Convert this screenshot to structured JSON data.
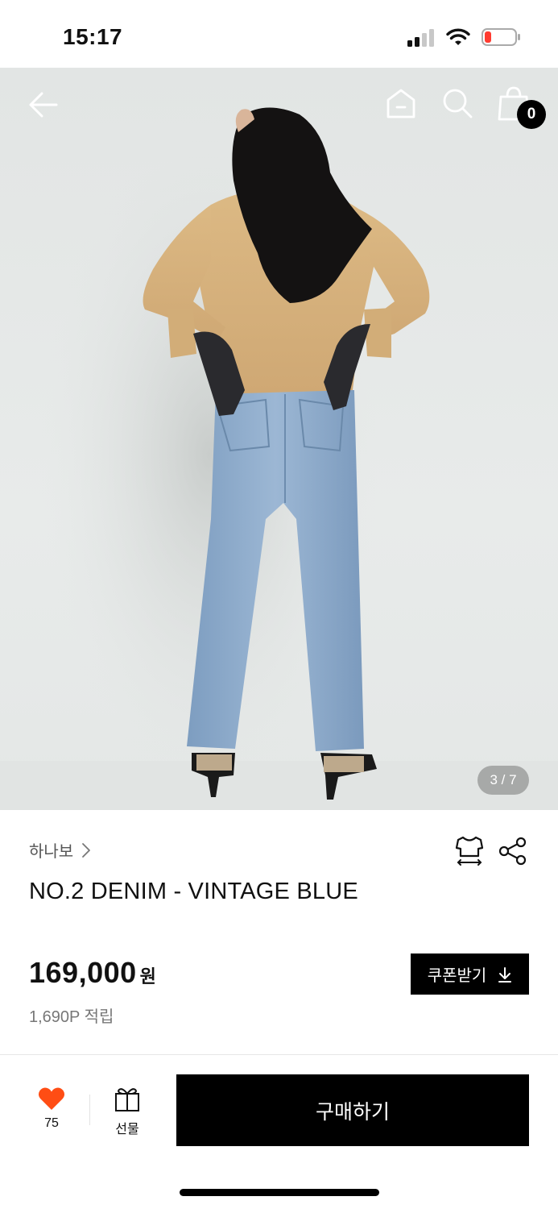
{
  "status_bar": {
    "time": "15:17"
  },
  "header": {
    "icons": [
      "back-arrow-icon",
      "home-icon",
      "search-icon",
      "shopping-bag-icon"
    ],
    "cart_count": "0"
  },
  "gallery": {
    "page_indicator": "3 / 7",
    "current_index": 3,
    "total": 7
  },
  "product": {
    "brand": "하나보",
    "name": "NO.2 DENIM - VINTAGE BLUE",
    "price": "169,000",
    "price_unit": "원",
    "points": "1,690P 적립",
    "coupon_label": "쿠폰받기",
    "action_icons": [
      "size-guide-icon",
      "share-icon"
    ]
  },
  "bottom_bar": {
    "like_count": "75",
    "gift_label": "선물",
    "buy_label": "구매하기"
  },
  "colors": {
    "accent_heart": "#ff4d14",
    "primary_button": "#000000"
  }
}
